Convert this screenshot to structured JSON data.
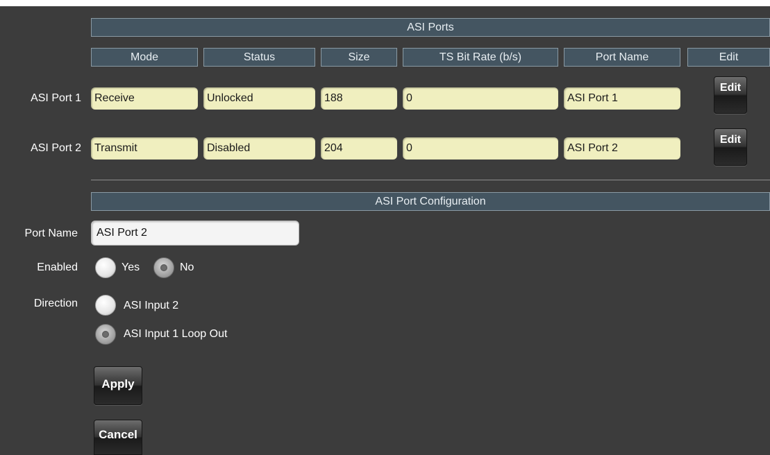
{
  "asi_ports": {
    "title": "ASI Ports",
    "columns": [
      "Mode",
      "Status",
      "Size",
      "TS Bit Rate (b/s)",
      "Port Name",
      "Edit"
    ],
    "rows": [
      {
        "label": "ASI Port 1",
        "mode": "Receive",
        "status": "Unlocked",
        "size": "188",
        "bitrate": "0",
        "port_name": "ASI Port 1",
        "edit_label": "Edit"
      },
      {
        "label": "ASI Port 2",
        "mode": "Transmit",
        "status": "Disabled",
        "size": "204",
        "bitrate": "0",
        "port_name": "ASI Port 2",
        "edit_label": "Edit"
      }
    ]
  },
  "config": {
    "title": "ASI Port Configuration",
    "port_name_label": "Port Name",
    "port_name_value": "ASI Port 2",
    "enabled_label": "Enabled",
    "enabled_options": [
      "Yes",
      "No"
    ],
    "enabled_selected": "No",
    "direction_label": "Direction",
    "direction_options": [
      "ASI Input 2",
      "ASI Input 1 Loop Out"
    ],
    "direction_selected": "ASI Input 1 Loop Out",
    "apply_label": "Apply",
    "cancel_label": "Cancel"
  },
  "colors": {
    "panel_bg": "#3c3c3c",
    "header_bg": "#445561",
    "field_bg": "#f0efbf"
  }
}
